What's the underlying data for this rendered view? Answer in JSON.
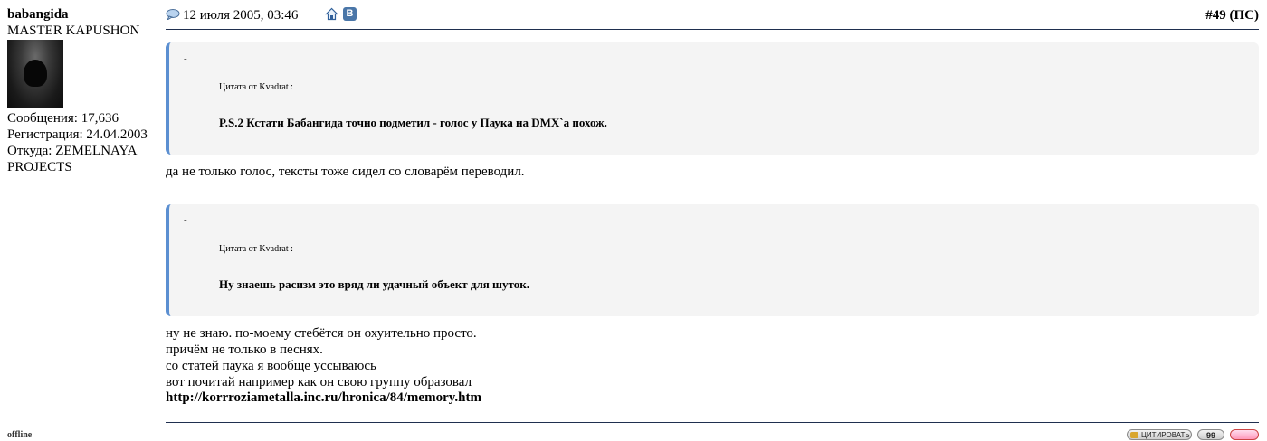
{
  "user": {
    "name": "babangida",
    "title": "MASTER KAPUSHON",
    "posts_label": "Сообщения: 17,636",
    "reg_label": "Регистрация: 24.04.2003",
    "from_label": "Откуда: ZEMELNAYA",
    "from_label_2": "PROJECTS",
    "status": "offline"
  },
  "post": {
    "date": "12 июля 2005, 03:46",
    "vk_letter": "В",
    "number": "#49",
    "number_suffix": "(ПС)",
    "quotes": [
      {
        "dash": "-",
        "from": "Цитата от Kvadrat :",
        "text": "P.S.2 Кстати Бабангида точно подметил - голос у Паука на DMX`а похож."
      },
      {
        "dash": "-",
        "from": "Цитата от Kvadrat :",
        "text": "Ну знаешь расизм это вряд ли удачный объект для шуток."
      }
    ],
    "reply_1": "да не только голос, тексты тоже сидел со словарём переводил.",
    "reply_2": [
      "ну не знаю. по-моему стебётся он охуительно просто.",
      "причём не только в песнях.",
      "со статей паука я вообще уссываюсь",
      "вот почитай например как он свою группу образовал"
    ],
    "link": "http://korrroziametalla.inc.ru/hronica/84/memory.htm"
  },
  "buttons": {
    "quote": "ЦИТИРОВАТЬ",
    "multiquote": "99"
  },
  "icons": {
    "post_icon": "speech-bubble-icon",
    "home": "home-icon",
    "vk": "vk-icon"
  },
  "colors": {
    "quote_border": "#5b8fd1",
    "quote_bg": "#f4f4f4",
    "divider": "#1f2f4f"
  }
}
